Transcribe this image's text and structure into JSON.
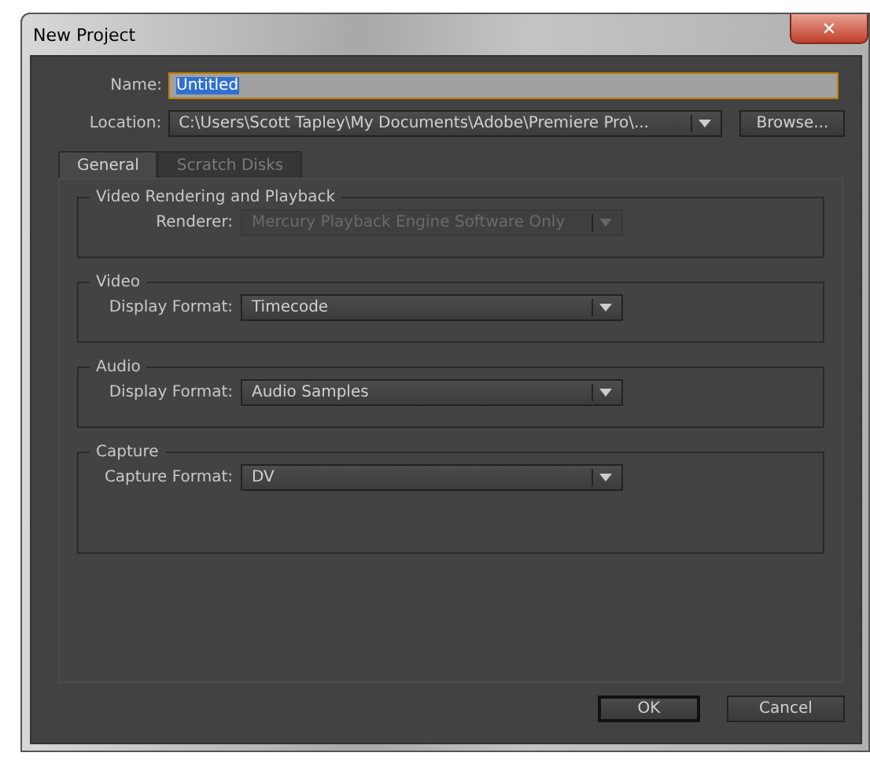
{
  "window": {
    "title": "New Project",
    "close": "✕"
  },
  "name_field": {
    "label": "Name:",
    "value": "Untitled",
    "text_selected": true
  },
  "location_field": {
    "label": "Location:",
    "value": "C:\\Users\\Scott Tapley\\My Documents\\Adobe\\Premiere Pro\\...",
    "browse": "Browse..."
  },
  "tabs": [
    {
      "label": "General",
      "selected": true
    },
    {
      "label": "Scratch Disks",
      "selected": false
    }
  ],
  "groups": [
    {
      "title": "Video Rendering and Playback",
      "field": {
        "label": "Renderer:",
        "value": "Mercury Playback Engine Software Only",
        "disabled": true
      }
    },
    {
      "title": "Video",
      "field": {
        "label": "Display Format:",
        "value": "Timecode",
        "disabled": false
      }
    },
    {
      "title": "Audio",
      "field": {
        "label": "Display Format:",
        "value": "Audio Samples",
        "disabled": false
      }
    },
    {
      "title": "Capture",
      "field": {
        "label": "Capture Format:",
        "value": "DV",
        "disabled": false
      }
    }
  ],
  "buttons": [
    {
      "label": "OK",
      "default": true
    },
    {
      "label": "Cancel",
      "default": false
    }
  ]
}
